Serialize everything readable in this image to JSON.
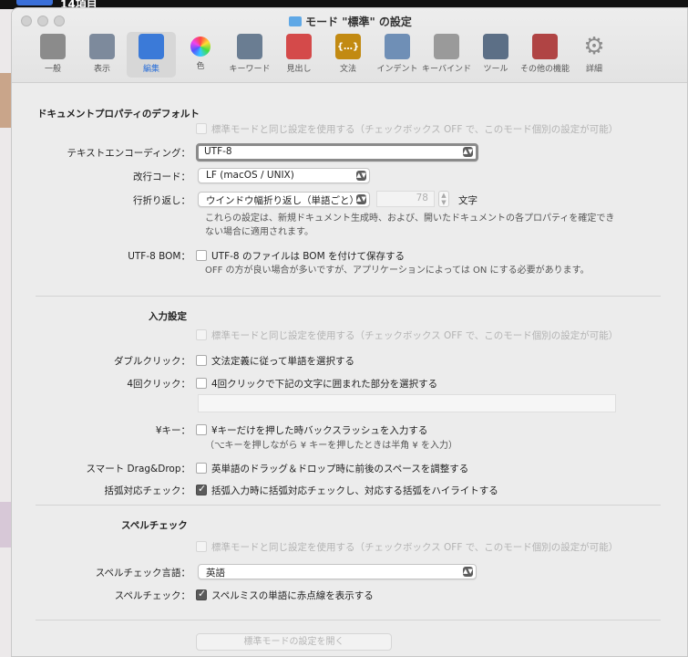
{
  "background": {
    "tab_text": "14項目"
  },
  "window": {
    "title": "モード \"標準\" の設定"
  },
  "toolbar": [
    {
      "label": "一般",
      "icon": "general-icon",
      "color": "#8b8b8b"
    },
    {
      "label": "表示",
      "icon": "display-icon",
      "color": "#7d8a9c"
    },
    {
      "label": "編集",
      "icon": "edit-icon",
      "color": "#3b7ad8",
      "active": true
    },
    {
      "label": "色",
      "icon": "color-wheel-icon",
      "color": "#e05aa0"
    },
    {
      "label": "キーワード",
      "icon": "keyword-icon",
      "color": "#6a7d92"
    },
    {
      "label": "見出し",
      "icon": "heading-icon",
      "color": "#d44a4a"
    },
    {
      "label": "文法",
      "icon": "syntax-icon",
      "color": "#c28a12"
    },
    {
      "label": "インデント",
      "icon": "indent-icon",
      "color": "#6f8fb6"
    },
    {
      "label": "キーバインド",
      "icon": "keybind-icon",
      "color": "#9a9a9a"
    },
    {
      "label": "ツール",
      "icon": "tools-icon",
      "color": "#5c6f86"
    },
    {
      "label": "その他の機能",
      "icon": "extras-icon",
      "color": "#b04444"
    },
    {
      "label": "詳細",
      "icon": "gear-icon",
      "color": "#8c8c8c"
    }
  ],
  "doc": {
    "section": "ドキュメントプロパティのデフォルト",
    "use_std": "標準モードと同じ設定を使用する（チェックボックス OFF で、このモード個別の設定が可能）",
    "encoding_label": "テキストエンコーディング：",
    "encoding_value": "UTF-8",
    "newline_label": "改行コード：",
    "newline_value": "LF (macOS / UNIX)",
    "wrap_label": "行折り返し：",
    "wrap_value": "ウインドウ幅折り返し（単語ごと）",
    "wrap_width": "78",
    "wrap_unit": "文字",
    "note1": "これらの設定は、新規ドキュメント生成時、および、開いたドキュメントの各プロパティを確定でき",
    "note2": "ない場合に適用されます。",
    "bom_label": "UTF-8 BOM：",
    "bom_text": "UTF-8 のファイルは BOM を付けて保存する",
    "bom_note": "OFF の方が良い場合が多いですが、アプリケーションによっては ON にする必要があります。"
  },
  "input": {
    "section": "入力設定",
    "use_std": "標準モードと同じ設定を使用する（チェックボックス OFF で、このモード個別の設定が可能）",
    "dbl_label": "ダブルクリック：",
    "dbl_text": "文法定義に従って単語を選択する",
    "quad_label": "4回クリック：",
    "quad_text": "4回クリックで下記の文字に囲まれた部分を選択する",
    "quad_chars": "",
    "yen_label": "¥キー：",
    "yen_text": "¥キーだけを押した時バックスラッシュを入力する",
    "yen_note": "（⌥キーを押しながら ¥ キーを押したときは半角 ¥ を入力）",
    "dnd_label": "スマート Drag&Drop：",
    "dnd_text": "英単語のドラッグ＆ドロップ時に前後のスペースを調整する",
    "bracket_label": "括弧対応チェック：",
    "bracket_text": "括弧入力時に括弧対応チェックし、対応する括弧をハイライトする"
  },
  "spell": {
    "section": "スペルチェック",
    "use_std": "標準モードと同じ設定を使用する（チェックボックス OFF で、このモード個別の設定が可能）",
    "lang_label": "スペルチェック言語：",
    "lang_value": "英語",
    "check_label": "スペルチェック：",
    "check_text": "スペルミスの単語に赤点線を表示する"
  },
  "open_std_button": "標準モードの設定を開く"
}
